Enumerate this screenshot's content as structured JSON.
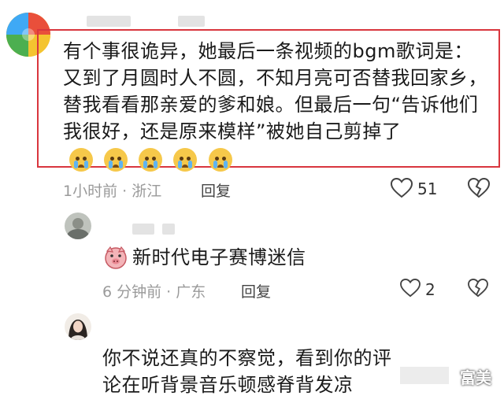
{
  "comment": {
    "text": "有个事很诡异，她最后一条视频的bgm歌词是：又到了月圆时人不圆，不知月亮可否替我回家乡，替我看看那亲爱的爹和娘。但最后一句“告诉他们我很好，还是原来模样”被她自己剪掉了",
    "emoji": "crying-face-icon",
    "emoji_count": 5,
    "meta": "1小时前 · 浙江",
    "reply_label": "回复",
    "like_count": "51"
  },
  "reply1": {
    "text": "新时代电子赛博迷信",
    "meta": "6 分钟前 · 广东",
    "reply_label": "回复",
    "like_count": "2"
  },
  "reply2": {
    "text": "你不说还真的不察觉，看到你的评论在听背景音乐顿感脊背发凉"
  },
  "watermark": "富美",
  "colors": {
    "highlight": "#d9363e",
    "meta_gray": "#9a9a9a"
  }
}
